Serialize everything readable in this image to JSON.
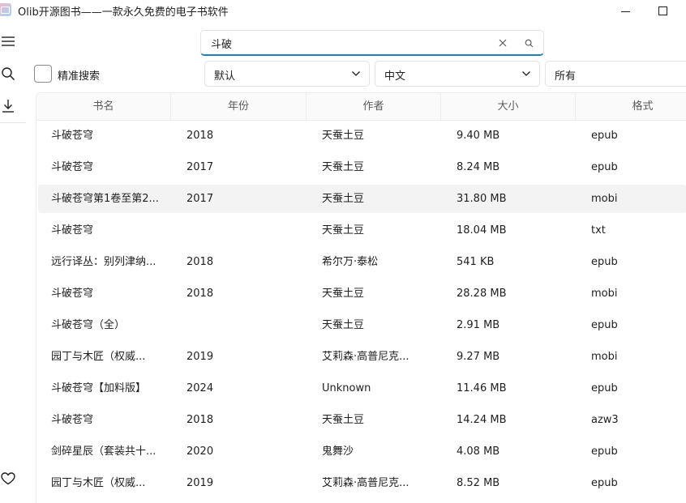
{
  "window": {
    "title": "Olib开源图书——一款永久免费的电子书软件",
    "app_icon": "book-app-icon",
    "controls": [
      "minimize-icon",
      "maximize-icon"
    ]
  },
  "sidebar": {
    "icons": [
      "menu-icon",
      "search-icon",
      "download-icon",
      "heart-icon"
    ]
  },
  "search": {
    "value": "斗破",
    "placeholder": "",
    "clear_icon": "close-icon",
    "search_icon": "search-icon"
  },
  "filters": {
    "exact_search_label": "精准搜索",
    "exact_search_checked": false,
    "sort": {
      "selected": "默认"
    },
    "language": {
      "selected": "中文"
    },
    "format": {
      "selected": "所有"
    }
  },
  "table": {
    "columns": [
      "书名",
      "年份",
      "作者",
      "大小",
      "格式"
    ],
    "rows": [
      {
        "title": "斗破苍穹",
        "year": "2018",
        "author": "天蚕土豆",
        "size": "9.40 MB",
        "format": "epub"
      },
      {
        "title": "斗破苍穹",
        "year": "2017",
        "author": "天蚕土豆",
        "size": "8.24 MB",
        "format": "epub"
      },
      {
        "title": "斗破苍穹第1卷至第2...",
        "year": "2017",
        "author": "天蚕土豆",
        "size": "31.80 MB",
        "format": "mobi"
      },
      {
        "title": "斗破苍穹",
        "year": "",
        "author": "天蚕土豆",
        "size": "18.04 MB",
        "format": "txt"
      },
      {
        "title": "远行译丛：别列津纳...",
        "year": "2018",
        "author": "希尔万·泰松",
        "size": "541 KB",
        "format": "epub"
      },
      {
        "title": "斗破苍穹",
        "year": "2018",
        "author": "天蚕土豆",
        "size": "28.28 MB",
        "format": "mobi"
      },
      {
        "title": "斗破苍穹（全）",
        "year": "",
        "author": "天蚕土豆",
        "size": "2.91 MB",
        "format": "epub"
      },
      {
        "title": "园丁与木匠（权威...",
        "year": "2019",
        "author": "艾莉森·高普尼克...",
        "size": "9.27 MB",
        "format": "mobi"
      },
      {
        "title": "斗破苍穹【加料版】",
        "year": "2024",
        "author": "Unknown",
        "size": "11.46 MB",
        "format": "epub"
      },
      {
        "title": "斗破苍穹",
        "year": "2018",
        "author": "天蚕土豆",
        "size": "14.24 MB",
        "format": "azw3"
      },
      {
        "title": "剑碎星辰（套装共十...",
        "year": "2020",
        "author": "鬼舞沙",
        "size": "4.08 MB",
        "format": "epub"
      },
      {
        "title": "园丁与木匠（权威...",
        "year": "2019",
        "author": "艾莉森·高普尼克...",
        "size": "8.52 MB",
        "format": "epub"
      }
    ],
    "highlighted_row": 2
  },
  "colors": {
    "accent": "#1f7fb8",
    "row_highlight": "#f3f3f3"
  }
}
